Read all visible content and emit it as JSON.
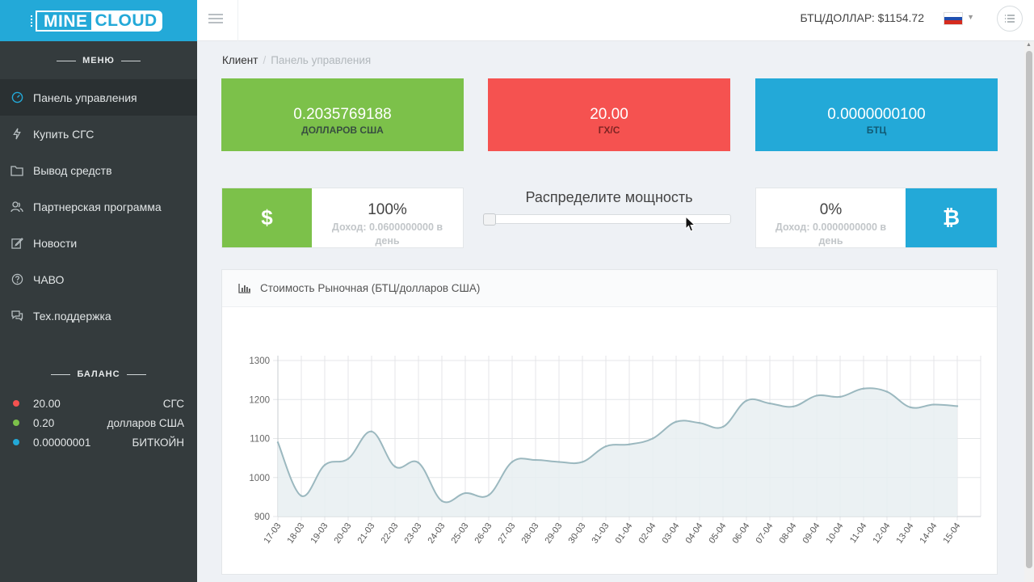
{
  "logo": {
    "part1": "MINE",
    "part2": "CLOUD"
  },
  "header": {
    "rate": "БТЦ/ДОЛЛАР: $1154.72"
  },
  "sidebar": {
    "menu_title": "МЕНЮ",
    "items": [
      {
        "label": "Панель управления",
        "icon": "dashboard-icon",
        "active": true
      },
      {
        "label": "Купить СГС",
        "icon": "bolt-icon"
      },
      {
        "label": "Вывод средств",
        "icon": "folder-icon"
      },
      {
        "label": "Партнерская программа",
        "icon": "users-icon"
      },
      {
        "label": "Новости",
        "icon": "edit-icon"
      },
      {
        "label": "ЧАВО",
        "icon": "question-icon"
      },
      {
        "label": "Тех.поддержка",
        "icon": "chat-icon"
      }
    ],
    "balance_title": "БАЛАНС",
    "balance": [
      {
        "value": "20.00",
        "unit": "СГС",
        "color": "#f55250"
      },
      {
        "value": "0.20",
        "unit": "долларов США",
        "color": "#7cc14a"
      },
      {
        "value": "0.00000001",
        "unit": "БИТКОЙН",
        "color": "#23a9d8"
      }
    ]
  },
  "breadcrumb": {
    "root": "Клиент",
    "current": "Панель управления"
  },
  "stats": {
    "usd": {
      "value": "0.2035769188",
      "label": "ДОЛЛАРОВ США"
    },
    "hash": {
      "value": "20.00",
      "label": "ГХ/С"
    },
    "btc": {
      "value": "0.0000000100",
      "label": "БТЦ"
    }
  },
  "allocation": {
    "title": "Распределите мощность",
    "usd": {
      "icon": "$",
      "percent": "100%",
      "income": "Доход: 0.0600000000 в день"
    },
    "btc": {
      "icon": "₿",
      "percent": "0%",
      "income": "Доход: 0.0000000000 в день"
    },
    "slider_value": 0
  },
  "chart_panel": {
    "title": "Стоимость Рыночная (БТЦ/долларов США)"
  },
  "chart_data": {
    "type": "area",
    "categories": [
      "17-03",
      "18-03",
      "19-03",
      "20-03",
      "21-03",
      "22-03",
      "23-03",
      "24-03",
      "25-03",
      "26-03",
      "27-03",
      "28-03",
      "29-03",
      "30-03",
      "31-03",
      "01-04",
      "02-04",
      "03-04",
      "04-04",
      "05-04",
      "06-04",
      "07-04",
      "08-04",
      "09-04",
      "10-04",
      "11-04",
      "12-04",
      "13-04",
      "14-04",
      "15-04"
    ],
    "values": [
      1090,
      953,
      1032,
      1048,
      1118,
      1028,
      1038,
      940,
      960,
      955,
      1040,
      1045,
      1040,
      1040,
      1080,
      1085,
      1100,
      1143,
      1140,
      1130,
      1197,
      1190,
      1182,
      1210,
      1207,
      1228,
      1220,
      1180,
      1187,
      1183
    ],
    "ylim": [
      900,
      1300
    ],
    "yticks": [
      900,
      1000,
      1100,
      1200,
      1300
    ],
    "grid": true,
    "line_color": "#9bb8bf",
    "fill_color": "#e7eff1"
  }
}
